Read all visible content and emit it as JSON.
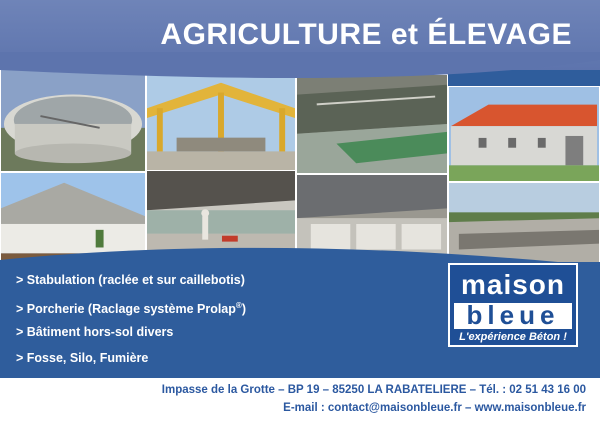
{
  "header": {
    "title": "AGRICULTURE et ÉLEVAGE"
  },
  "features": [
    {
      "text": "> Stabulation (raclée et sur caillebotis)"
    },
    {
      "text": "> Porcherie (Raclage système Prolap",
      "sup": "®",
      "after": ")"
    },
    {
      "text": "> Bâtiment hors-sol divers"
    },
    {
      "text": "> Fosse, Silo, Fumière"
    }
  ],
  "logo": {
    "word1": "maison",
    "word2": "bleue",
    "tagline": "L'expérience Béton !"
  },
  "footer": {
    "address": "Impasse de la Grotte – BP 19 – 85250 LA RABATELIERE – Tél. : 02 51 43 16 00",
    "contact": "E-mail : contact@maisonbleue.fr – www.maisonbleue.fr"
  },
  "colors": {
    "header": "#5d74ad",
    "blue": "#2f5d9c",
    "logo": "#1f4f96",
    "footer_text": "#2b58a0"
  },
  "photos": [
    {
      "icon": "circular-tank-photo"
    },
    {
      "icon": "barn-frame-photo"
    },
    {
      "icon": "stable-interior-photo"
    },
    {
      "icon": "red-roof-building-photo"
    },
    {
      "icon": "white-building-photo"
    },
    {
      "icon": "construction-site-photo"
    },
    {
      "icon": "concrete-pens-photo"
    },
    {
      "icon": "concrete-channel-photo"
    }
  ]
}
